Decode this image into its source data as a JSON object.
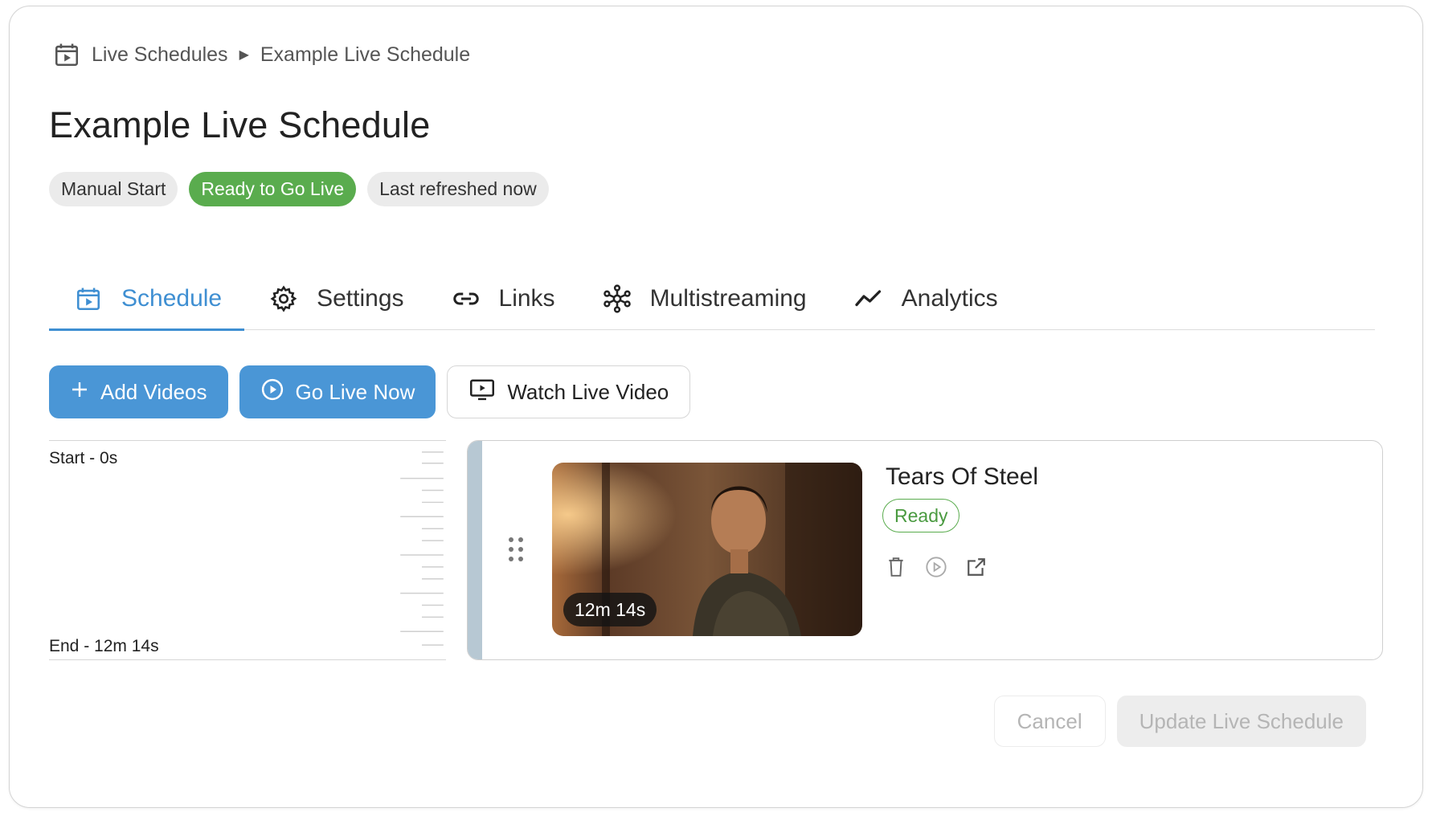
{
  "breadcrumb": {
    "icon": "live-schedule-icon",
    "root": "Live Schedules",
    "current": "Example Live Schedule"
  },
  "page": {
    "title": "Example Live Schedule"
  },
  "badges": {
    "manual_start": "Manual Start",
    "status": "Ready to Go Live",
    "refreshed": "Last refreshed now"
  },
  "tabs": [
    {
      "label": "Schedule",
      "icon": "calendar-play-icon",
      "active": true
    },
    {
      "label": "Settings",
      "icon": "gear-icon",
      "active": false
    },
    {
      "label": "Links",
      "icon": "link-icon",
      "active": false
    },
    {
      "label": "Multistreaming",
      "icon": "network-icon",
      "active": false
    },
    {
      "label": "Analytics",
      "icon": "chart-line-icon",
      "active": false
    }
  ],
  "actions": {
    "add_videos": "Add Videos",
    "go_live_now": "Go Live Now",
    "watch_live_video": "Watch Live Video"
  },
  "timeline": {
    "start_label": "Start - 0s",
    "end_label": "End - 12m 14s"
  },
  "video": {
    "title": "Tears Of Steel",
    "status": "Ready",
    "duration": "12m 14s"
  },
  "footer": {
    "cancel": "Cancel",
    "update": "Update Live Schedule"
  },
  "colors": {
    "accent_blue": "#4a96d6",
    "tab_active": "#3f8fd2",
    "ready_green": "#5aac4e"
  }
}
